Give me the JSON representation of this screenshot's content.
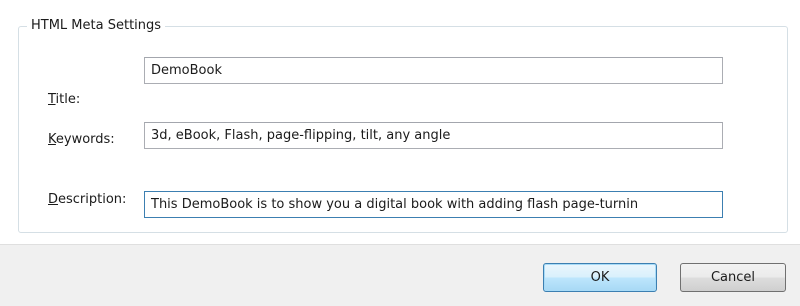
{
  "group": {
    "title": "HTML Meta Settings"
  },
  "fields": {
    "title": {
      "label_first": "T",
      "label_rest": "itle:",
      "value": "DemoBook"
    },
    "keywords": {
      "label_first": "K",
      "label_rest": "eywords:",
      "value": "3d, eBook, Flash, page-flipping, tilt, any angle"
    },
    "description": {
      "label_first": "D",
      "label_rest": "escription:",
      "value": "This DemoBook is to show you a digital book with adding flash page-turnin"
    }
  },
  "buttons": {
    "ok": "OK",
    "cancel": "Cancel"
  },
  "colors": {
    "focus_border": "#3c7fb1",
    "footer_bg": "#f0f0f0"
  }
}
